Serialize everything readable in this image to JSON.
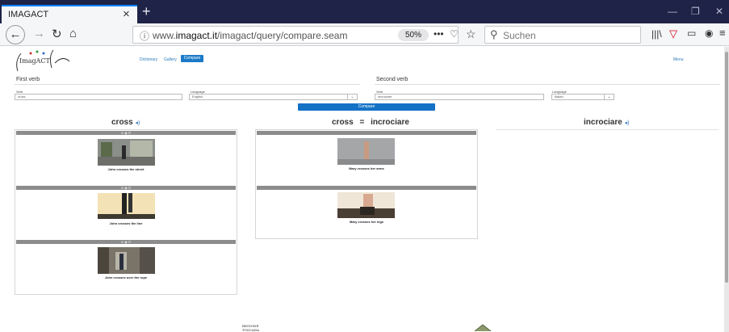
{
  "browser": {
    "tab_title": "IMAGACT",
    "tab_close": "×",
    "new_tab": "+",
    "url_prefix": "www.",
    "url_domain": "imagact.it",
    "url_path": "/imagact/query/compare.seam",
    "zoom": "50%",
    "search_placeholder": "Suchen"
  },
  "site": {
    "logo_text": "ImagACT",
    "nav": {
      "dictionary": "Dictionary",
      "gallery": "Gallery",
      "compare": "Compare"
    },
    "menu": "Menu"
  },
  "form": {
    "first_verb": {
      "section_title": "First verb",
      "verb_label": "Verb",
      "verb_value": "cross",
      "language_label": "Language",
      "language_value": "English"
    },
    "second_verb": {
      "section_title": "Second verb",
      "verb_label": "Verb",
      "verb_value": "incrociare",
      "language_label": "Language",
      "language_value": "Italian"
    },
    "compare_button": "Compare"
  },
  "results": {
    "left": {
      "heading": "cross",
      "cards": [
        {
          "bar": "⊘ ◉ ⊡",
          "caption": "John crosses the street"
        },
        {
          "bar": "⊘ ◉ ⊡",
          "caption": "John crosses the line"
        },
        {
          "bar": "⊘ ◉ ⊡",
          "caption": "John crosses over the rope"
        }
      ]
    },
    "middle": {
      "heading_a": "cross",
      "equals": "=",
      "heading_b": "incrociare",
      "cards": [
        {
          "caption": "Mary crosses her arms"
        },
        {
          "caption": "Mary crosses her legs"
        }
      ]
    },
    "right": {
      "heading": "incrociare"
    }
  },
  "footer": {
    "region_logo": "REGIONE TOSCANA"
  },
  "colors": {
    "accent": "#1472c6",
    "tabbar": "#1f2347",
    "pocket_red": "#d70022"
  }
}
